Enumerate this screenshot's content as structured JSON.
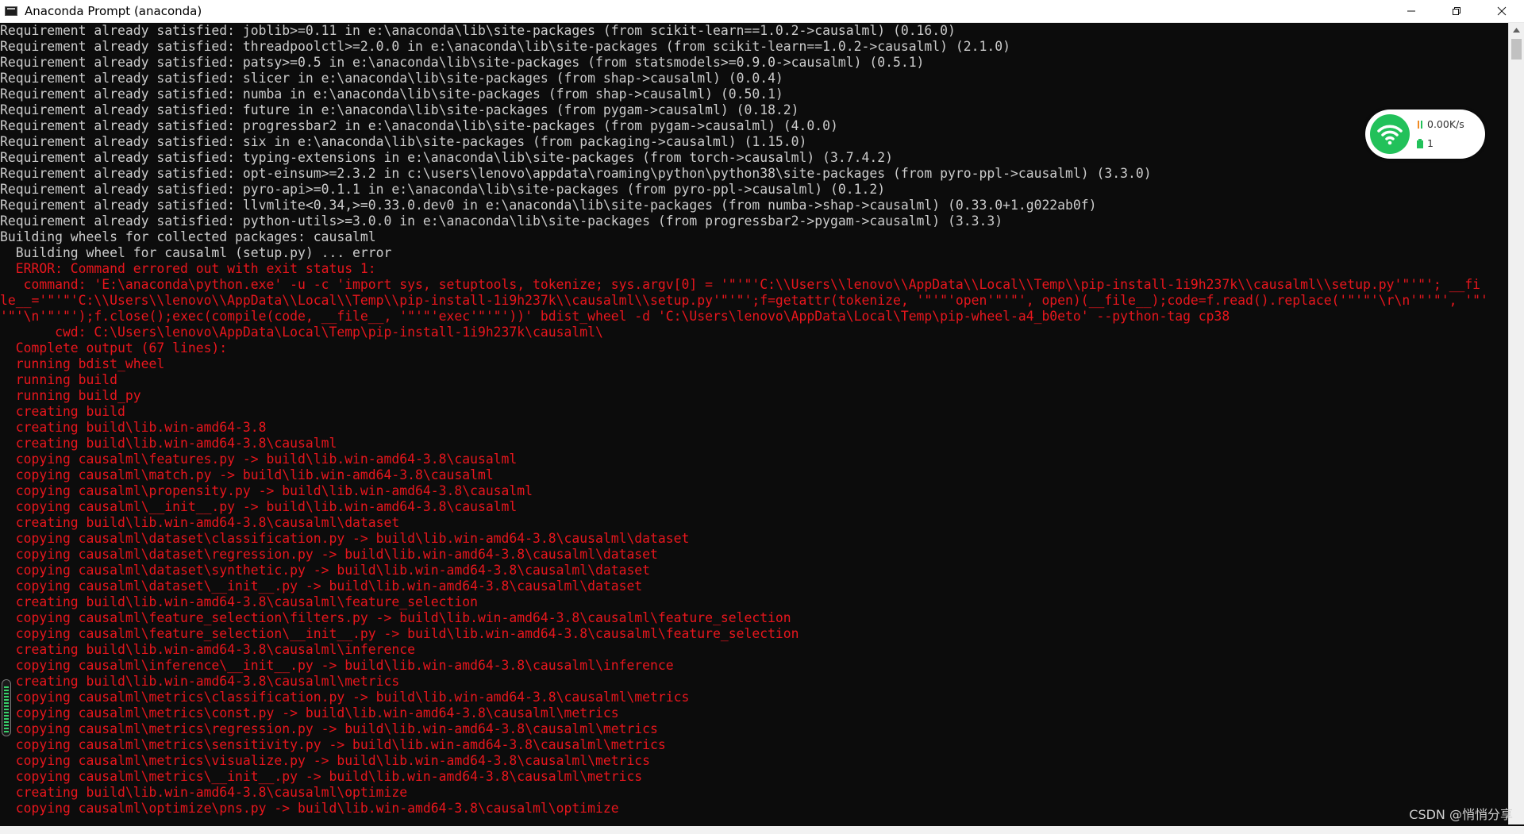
{
  "window": {
    "title": "Anaconda Prompt (anaconda)",
    "minimize_icon": "minimize-icon",
    "restore_icon": "restore-icon",
    "close_icon": "close-icon"
  },
  "console": {
    "lines": [
      {
        "text": "Requirement already satisfied: joblib>=0.11 in e:\\anaconda\\lib\\site-packages (from scikit-learn==1.0.2->causalml) (0.16.0)",
        "err": false
      },
      {
        "text": "Requirement already satisfied: threadpoolctl>=2.0.0 in e:\\anaconda\\lib\\site-packages (from scikit-learn==1.0.2->causalml) (2.1.0)",
        "err": false
      },
      {
        "text": "Requirement already satisfied: patsy>=0.5 in e:\\anaconda\\lib\\site-packages (from statsmodels>=0.9.0->causalml) (0.5.1)",
        "err": false
      },
      {
        "text": "Requirement already satisfied: slicer in e:\\anaconda\\lib\\site-packages (from shap->causalml) (0.0.4)",
        "err": false
      },
      {
        "text": "Requirement already satisfied: numba in e:\\anaconda\\lib\\site-packages (from shap->causalml) (0.50.1)",
        "err": false
      },
      {
        "text": "Requirement already satisfied: future in e:\\anaconda\\lib\\site-packages (from pygam->causalml) (0.18.2)",
        "err": false
      },
      {
        "text": "Requirement already satisfied: progressbar2 in e:\\anaconda\\lib\\site-packages (from pygam->causalml) (4.0.0)",
        "err": false
      },
      {
        "text": "Requirement already satisfied: six in e:\\anaconda\\lib\\site-packages (from packaging->causalml) (1.15.0)",
        "err": false
      },
      {
        "text": "Requirement already satisfied: typing-extensions in e:\\anaconda\\lib\\site-packages (from torch->causalml) (3.7.4.2)",
        "err": false
      },
      {
        "text": "Requirement already satisfied: opt-einsum>=2.3.2 in c:\\users\\lenovo\\appdata\\roaming\\python\\python38\\site-packages (from pyro-ppl->causalml) (3.3.0)",
        "err": false
      },
      {
        "text": "Requirement already satisfied: pyro-api>=0.1.1 in e:\\anaconda\\lib\\site-packages (from pyro-ppl->causalml) (0.1.2)",
        "err": false
      },
      {
        "text": "Requirement already satisfied: llvmlite<0.34,>=0.33.0.dev0 in e:\\anaconda\\lib\\site-packages (from numba->shap->causalml) (0.33.0+1.g022ab0f)",
        "err": false
      },
      {
        "text": "Requirement already satisfied: python-utils>=3.0.0 in e:\\anaconda\\lib\\site-packages (from progressbar2->pygam->causalml) (3.3.3)",
        "err": false
      },
      {
        "text": "Building wheels for collected packages: causalml",
        "err": false
      },
      {
        "text": "  Building wheel for causalml (setup.py) ... error",
        "err": false
      },
      {
        "text": "  ERROR: Command errored out with exit status 1:",
        "err": true
      },
      {
        "text": "   command: 'E:\\anaconda\\python.exe' -u -c 'import sys, setuptools, tokenize; sys.argv[0] = '\"'\"'C:\\\\Users\\\\lenovo\\\\AppData\\\\Local\\\\Temp\\\\pip-install-1i9h237k\\\\causalml\\\\setup.py'\"'\"'; __fi",
        "err": true
      },
      {
        "text": "le__='\"'\"'C:\\\\Users\\\\lenovo\\\\AppData\\\\Local\\\\Temp\\\\pip-install-1i9h237k\\\\causalml\\\\setup.py'\"'\"';f=getattr(tokenize, '\"'\"'open'\"'\"', open)(__file__);code=f.read().replace('\"'\"'\\r\\n'\"'\"', '\"'",
        "err": true
      },
      {
        "text": "'\"'\\n'\"'\"');f.close();exec(compile(code, __file__, '\"'\"'exec'\"'\"'))' bdist_wheel -d 'C:\\Users\\lenovo\\AppData\\Local\\Temp\\pip-wheel-a4_b0eto' --python-tag cp38",
        "err": true
      },
      {
        "text": "       cwd: C:\\Users\\lenovo\\AppData\\Local\\Temp\\pip-install-1i9h237k\\causalml\\",
        "err": true
      },
      {
        "text": "  Complete output (67 lines):",
        "err": true
      },
      {
        "text": "  running bdist_wheel",
        "err": true
      },
      {
        "text": "  running build",
        "err": true
      },
      {
        "text": "  running build_py",
        "err": true
      },
      {
        "text": "  creating build",
        "err": true
      },
      {
        "text": "  creating build\\lib.win-amd64-3.8",
        "err": true
      },
      {
        "text": "  creating build\\lib.win-amd64-3.8\\causalml",
        "err": true
      },
      {
        "text": "  copying causalml\\features.py -> build\\lib.win-amd64-3.8\\causalml",
        "err": true
      },
      {
        "text": "  copying causalml\\match.py -> build\\lib.win-amd64-3.8\\causalml",
        "err": true
      },
      {
        "text": "  copying causalml\\propensity.py -> build\\lib.win-amd64-3.8\\causalml",
        "err": true
      },
      {
        "text": "  copying causalml\\__init__.py -> build\\lib.win-amd64-3.8\\causalml",
        "err": true
      },
      {
        "text": "  creating build\\lib.win-amd64-3.8\\causalml\\dataset",
        "err": true
      },
      {
        "text": "  copying causalml\\dataset\\classification.py -> build\\lib.win-amd64-3.8\\causalml\\dataset",
        "err": true
      },
      {
        "text": "  copying causalml\\dataset\\regression.py -> build\\lib.win-amd64-3.8\\causalml\\dataset",
        "err": true
      },
      {
        "text": "  copying causalml\\dataset\\synthetic.py -> build\\lib.win-amd64-3.8\\causalml\\dataset",
        "err": true
      },
      {
        "text": "  copying causalml\\dataset\\__init__.py -> build\\lib.win-amd64-3.8\\causalml\\dataset",
        "err": true
      },
      {
        "text": "  creating build\\lib.win-amd64-3.8\\causalml\\feature_selection",
        "err": true
      },
      {
        "text": "  copying causalml\\feature_selection\\filters.py -> build\\lib.win-amd64-3.8\\causalml\\feature_selection",
        "err": true
      },
      {
        "text": "  copying causalml\\feature_selection\\__init__.py -> build\\lib.win-amd64-3.8\\causalml\\feature_selection",
        "err": true
      },
      {
        "text": "  creating build\\lib.win-amd64-3.8\\causalml\\inference",
        "err": true
      },
      {
        "text": "  copying causalml\\inference\\__init__.py -> build\\lib.win-amd64-3.8\\causalml\\inference",
        "err": true
      },
      {
        "text": "  creating build\\lib.win-amd64-3.8\\causalml\\metrics",
        "err": true
      },
      {
        "text": "  copying causalml\\metrics\\classification.py -> build\\lib.win-amd64-3.8\\causalml\\metrics",
        "err": true
      },
      {
        "text": "  copying causalml\\metrics\\const.py -> build\\lib.win-amd64-3.8\\causalml\\metrics",
        "err": true
      },
      {
        "text": "  copying causalml\\metrics\\regression.py -> build\\lib.win-amd64-3.8\\causalml\\metrics",
        "err": true
      },
      {
        "text": "  copying causalml\\metrics\\sensitivity.py -> build\\lib.win-amd64-3.8\\causalml\\metrics",
        "err": true
      },
      {
        "text": "  copying causalml\\metrics\\visualize.py -> build\\lib.win-amd64-3.8\\causalml\\metrics",
        "err": true
      },
      {
        "text": "  copying causalml\\metrics\\__init__.py -> build\\lib.win-amd64-3.8\\causalml\\metrics",
        "err": true
      },
      {
        "text": "  creating build\\lib.win-amd64-3.8\\causalml\\optimize",
        "err": true
      },
      {
        "text": "  copying causalml\\optimize\\pns.py -> build\\lib.win-amd64-3.8\\causalml\\optimize",
        "err": true
      }
    ]
  },
  "network_widget": {
    "wifi_icon": "wifi-icon",
    "speed": "0.00K/s",
    "count": "1"
  },
  "watermark": "CSDN @悄悄分享",
  "colors": {
    "console_bg": "#0c0c0c",
    "console_text": "#cccccc",
    "error_text": "#e8161d",
    "wifi_green": "#22c15a"
  }
}
